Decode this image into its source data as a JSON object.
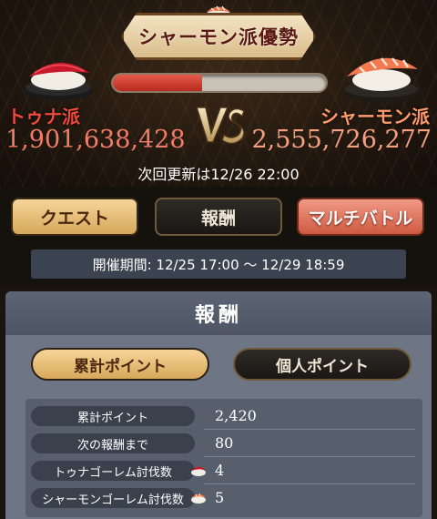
{
  "banner": {
    "title": "シャーモン派優勢"
  },
  "battle": {
    "left_faction": "トゥナ派",
    "left_score": "1,901,638,428",
    "right_faction": "シャーモン派",
    "right_score": "2,555,726,277",
    "gauge_left_fraction": 0.42,
    "next_update": "次回更新は12/26 22:00"
  },
  "tabs": {
    "quest": "クエスト",
    "reward": "報酬",
    "multi_battle": "マルチバトル"
  },
  "period": {
    "text": "開催期間: 12/25 17:00 〜 12/29 18:59"
  },
  "panel": {
    "title": "報酬",
    "total_points_button": "累計ポイント",
    "personal_points_button": "個人ポイント"
  },
  "stats": [
    {
      "label": "累計ポイント",
      "value": "2,420",
      "icon": ""
    },
    {
      "label": "次の報酬まで",
      "value": "80",
      "icon": ""
    },
    {
      "label": "トゥナゴーレム討伐数",
      "value": "4",
      "icon": "tuna-sushi-icon"
    },
    {
      "label": "シャーモンゴーレム討伐数",
      "value": "5",
      "icon": "salmon-sushi-icon"
    }
  ],
  "colors": {
    "tuna": "#ee4a3c",
    "salmon": "#ff9a6a",
    "gold": "#d7a85a",
    "gauge_fill": "#c83228"
  }
}
